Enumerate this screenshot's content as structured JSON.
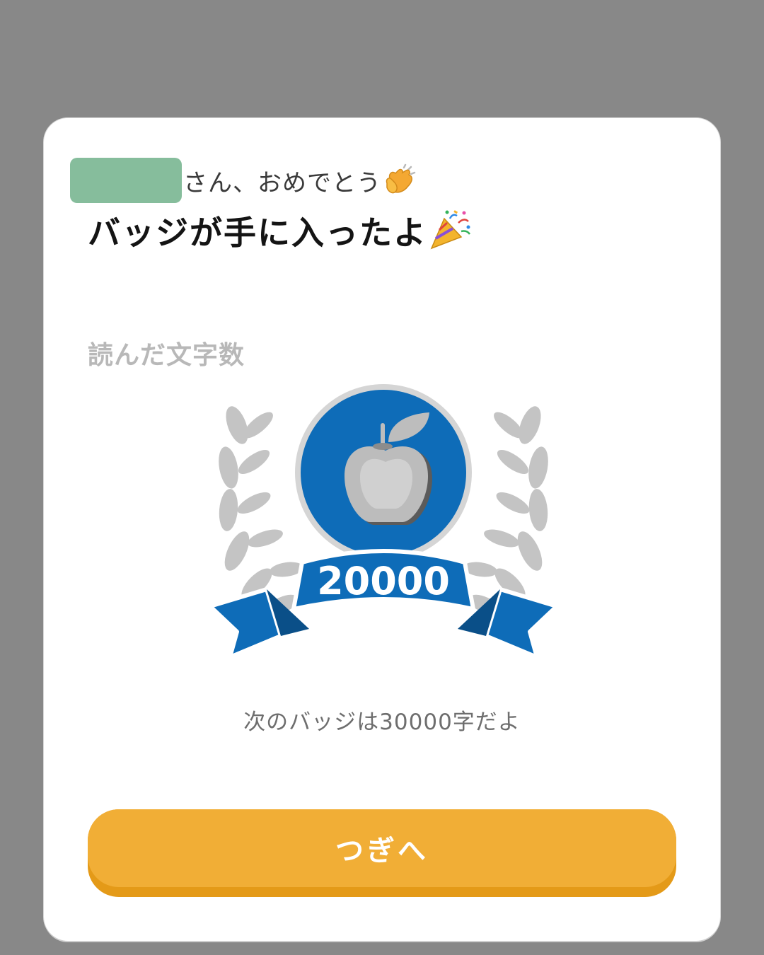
{
  "greeting": {
    "suffix": "さん、おめでとう",
    "emoji_icon": "clapping-hands-icon"
  },
  "headline": {
    "text": "バッジが手に入ったよ",
    "emoji_icon": "party-popper-icon"
  },
  "badge": {
    "category_label": "読んだ文字数",
    "milestone_value": "20000",
    "emblem_icon": "apple-icon",
    "laurel_icon": "laurel-wreath-icon",
    "next_note": "次のバッジは30000字だよ"
  },
  "actions": {
    "next_label": "つぎへ"
  },
  "colors": {
    "backdrop": "#888888",
    "badge_blue": "#0e6cb8",
    "laurel_gray": "#c4c4c4",
    "button_orange": "#f1ae36",
    "username_mask": "#86bd9c"
  }
}
